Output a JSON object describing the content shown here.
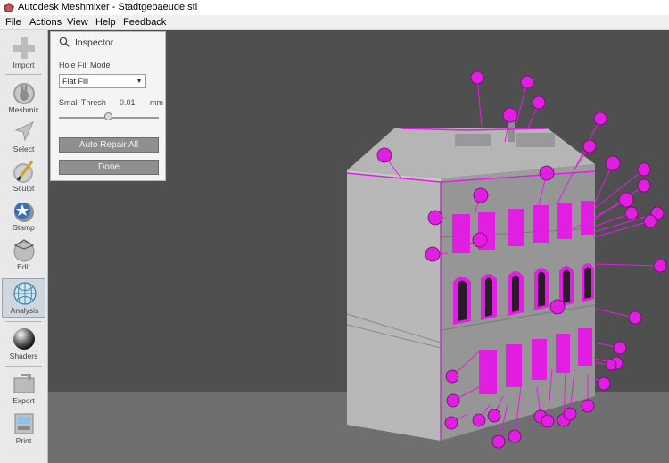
{
  "window": {
    "title": "Autodesk Meshmixer - Stadtgebaeude.stl"
  },
  "menu": [
    "File",
    "Actions",
    "View",
    "Help",
    "Feedback"
  ],
  "toolbar": [
    {
      "label": "Import",
      "icon": "plus-icon"
    },
    {
      "label": "Meshmix",
      "icon": "bunny-icon"
    },
    {
      "label": "Select",
      "icon": "arrow-cursor-icon"
    },
    {
      "label": "Sculpt",
      "icon": "brush-icon"
    },
    {
      "label": "Stamp",
      "icon": "stamp-icon"
    },
    {
      "label": "Edit",
      "icon": "edit-sphere-icon"
    },
    {
      "label": "Analysis",
      "icon": "analysis-sphere-icon",
      "active": true
    },
    {
      "label": "Shaders",
      "icon": "shader-sphere-icon"
    },
    {
      "label": "Export",
      "icon": "export-icon"
    },
    {
      "label": "Print",
      "icon": "printer-icon"
    }
  ],
  "inspector": {
    "title": "Inspector",
    "hole_fill_mode_label": "Hole Fill Mode",
    "hole_fill_mode_value": "Flat Fill",
    "small_thresh_label": "Small Thresh",
    "small_thresh_value": "0.01",
    "small_thresh_unit": "mm",
    "auto_repair_label": "Auto Repair All",
    "done_label": "Done"
  },
  "colors": {
    "viewport_bg": "#4f4f4f",
    "floor": "#6f6f6f",
    "mesh": "#a9a9a9",
    "highlight": "#e21ee2"
  }
}
